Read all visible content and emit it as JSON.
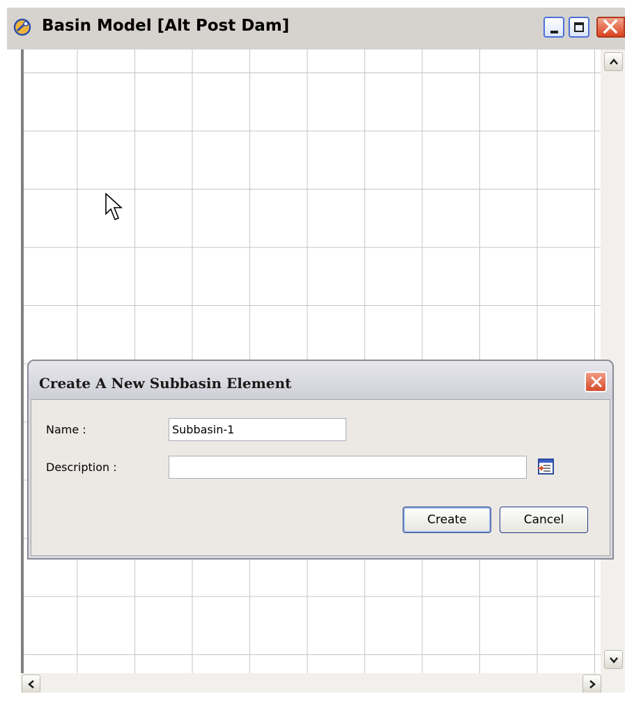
{
  "window": {
    "title": "Basin Model [Alt Post Dam]",
    "icons": [
      "app-icon",
      "minimize-icon",
      "maximize-icon",
      "close-icon"
    ]
  },
  "canvas": {
    "grid": true,
    "scrollbars": [
      "vertical",
      "horizontal"
    ]
  },
  "dialog": {
    "title": "Create A New Subbasin Element",
    "fields": {
      "name_label": "Name :",
      "name_value": "Subbasin-1",
      "description_label": "Description :",
      "description_value": ""
    },
    "buttons": {
      "create": "Create",
      "cancel": "Cancel"
    }
  },
  "colors": {
    "title_bar": "#d6d3ce",
    "dialog_bg": "#ece9e4",
    "close_button": "#d9431f",
    "grid_line": "#c4c4c4",
    "button_border": "#1f3a8a"
  }
}
